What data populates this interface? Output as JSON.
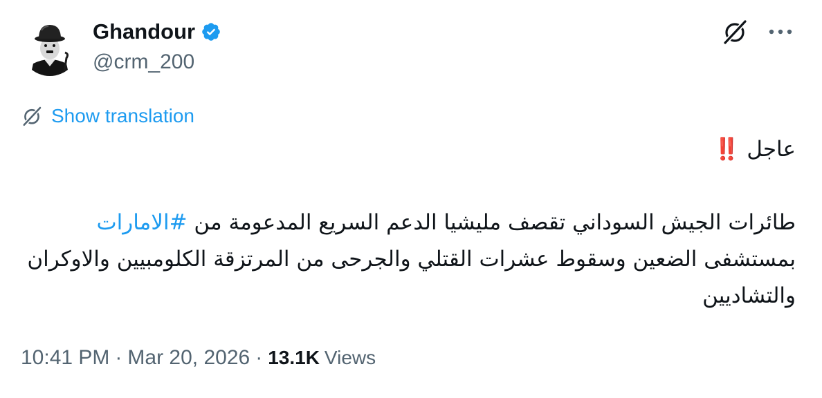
{
  "author": {
    "display_name": "Ghandour",
    "handle": "@crm_200",
    "verified": true,
    "avatar_icon": "charlie-chaplin-avatar"
  },
  "header_actions": {
    "grok_icon": "grok-slash-icon",
    "more_icon": "more-horizontal-icon"
  },
  "translation": {
    "icon": "grok-slash-icon",
    "label": "Show translation"
  },
  "body": {
    "line1_text": "عاجل",
    "line1_emoji": "‼️",
    "para_start": "طائرات الجيش السوداني تقصف مليشيا الدعم السريع المدعومة من ",
    "hashtag": "#الامارات",
    "para_end": " بمستشفى الضعين  وسقوط عشرات القتلي والجرحى من المرتزقة الكلومبيين والاوكران والتشاديين"
  },
  "meta": {
    "time": "10:41 PM",
    "separator": "·",
    "date": "Mar 20, 2026",
    "views_count": "13.1K",
    "views_label": "Views"
  },
  "colors": {
    "text_primary": "#0f1419",
    "text_secondary": "#536471",
    "link_blue": "#1d9bf0",
    "urgent_red": "#d0021b"
  }
}
